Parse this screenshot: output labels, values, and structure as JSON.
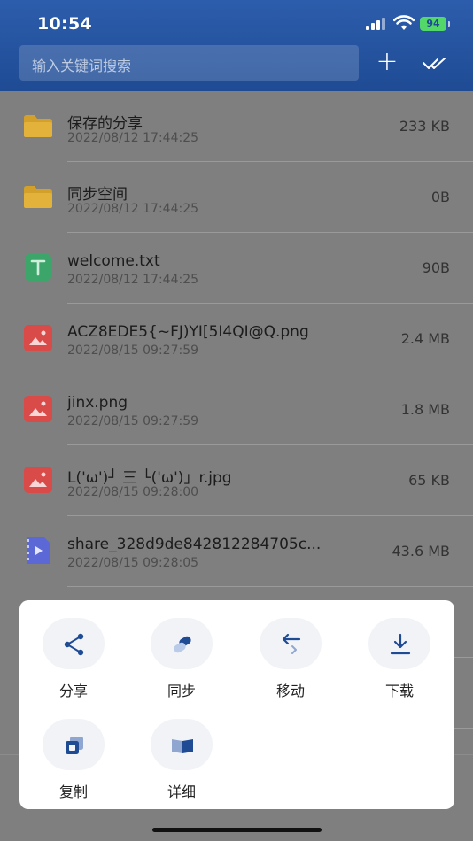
{
  "status": {
    "time": "10:54",
    "battery": "94"
  },
  "header": {
    "search_placeholder": "输入关键词搜索",
    "add_icon": "plus-icon",
    "select_icon": "double-check-icon"
  },
  "files": [
    {
      "name": "保存的分享",
      "date": "2022/08/12 17:44:25",
      "size": "233 KB",
      "type": "folder"
    },
    {
      "name": "同步空间",
      "date": "2022/08/12 17:44:25",
      "size": "0B",
      "type": "folder"
    },
    {
      "name": "welcome.txt",
      "date": "2022/08/12 17:44:25",
      "size": "90B",
      "type": "text"
    },
    {
      "name": "ACZ8EDE5{~FJ)YI[5I4QI@Q.png",
      "date": "2022/08/15 09:27:59",
      "size": "2.4 MB",
      "type": "image"
    },
    {
      "name": "jinx.png",
      "date": "2022/08/15 09:27:59",
      "size": "1.8 MB",
      "type": "image"
    },
    {
      "name": "L('ω')┘ 三 └('ω')」r.jpg",
      "date": "2022/08/15 09:28:00",
      "size": "65 KB",
      "type": "image"
    },
    {
      "name": "share_328d9de842812284705c...",
      "date": "2022/08/15 09:28:05",
      "size": "43.6 MB",
      "type": "video"
    }
  ],
  "actions": [
    {
      "label": "分享",
      "icon": "share-icon"
    },
    {
      "label": "同步",
      "icon": "sync-icon"
    },
    {
      "label": "移动",
      "icon": "move-icon"
    },
    {
      "label": "下载",
      "icon": "download-icon"
    },
    {
      "label": "复制",
      "icon": "copy-icon"
    },
    {
      "label": "详细",
      "icon": "details-icon"
    }
  ],
  "colors": {
    "header": "#2c5dac",
    "accent": "#1f4b94",
    "folder": "#d3a12b",
    "image": "#d94b48",
    "text": "#3ca56a",
    "video": "#5b68d6"
  }
}
